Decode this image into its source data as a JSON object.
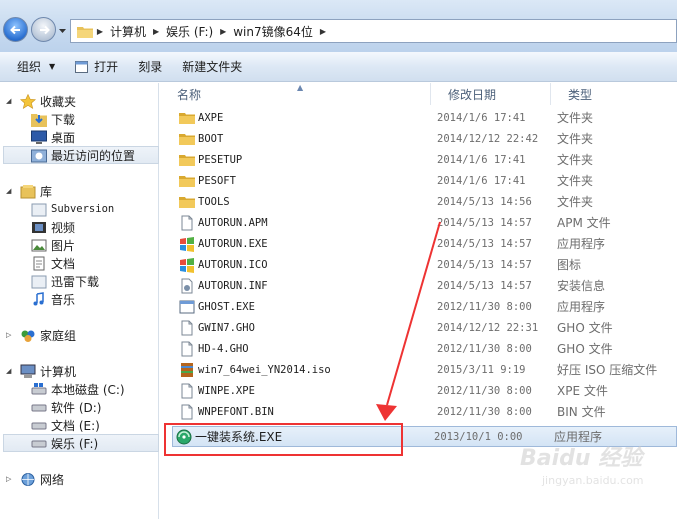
{
  "address": {
    "crumbs": [
      "计算机",
      "娱乐 (F:)",
      "win7镜像64位"
    ]
  },
  "toolbar": {
    "organize": "组织",
    "open": "打开",
    "burn": "刻录",
    "new_folder": "新建文件夹"
  },
  "nav": {
    "favorites": "收藏夹",
    "downloads": "下载",
    "desktop": "桌面",
    "recent": "最近访问的位置",
    "libraries": "库",
    "subversion": "Subversion",
    "videos": "视频",
    "pictures": "图片",
    "documents": "文档",
    "xunlei": "迅雷下载",
    "music": "音乐",
    "homegroup": "家庭组",
    "computer": "计算机",
    "drive_c": "本地磁盘 (C:)",
    "drive_d": "软件 (D:)",
    "drive_e": "文档 (E:)",
    "drive_f": "娱乐 (F:)",
    "network": "网络"
  },
  "columns": {
    "name": "名称",
    "date": "修改日期",
    "type": "类型"
  },
  "files": [
    {
      "name": "AXPE",
      "date": "2014/1/6 17:41",
      "type": "文件夹",
      "icon": "folder-icon"
    },
    {
      "name": "BOOT",
      "date": "2014/12/12 22:42",
      "type": "文件夹",
      "icon": "folder-icon"
    },
    {
      "name": "PESETUP",
      "date": "2014/1/6 17:41",
      "type": "文件夹",
      "icon": "folder-icon"
    },
    {
      "name": "PESOFT",
      "date": "2014/1/6 17:41",
      "type": "文件夹",
      "icon": "folder-icon"
    },
    {
      "name": "TOOLS",
      "date": "2014/5/13 14:56",
      "type": "文件夹",
      "icon": "folder-icon"
    },
    {
      "name": "AUTORUN.APM",
      "date": "2014/5/13 14:57",
      "type": "APM 文件",
      "icon": "blank-file-icon"
    },
    {
      "name": "AUTORUN.EXE",
      "date": "2014/5/13 14:57",
      "type": "应用程序",
      "icon": "windows-exe-icon"
    },
    {
      "name": "AUTORUN.ICO",
      "date": "2014/5/13 14:57",
      "type": "图标",
      "icon": "windows-exe-icon"
    },
    {
      "name": "AUTORUN.INF",
      "date": "2014/5/13 14:57",
      "type": "安装信息",
      "icon": "inf-file-icon"
    },
    {
      "name": "GHOST.EXE",
      "date": "2012/11/30 8:00",
      "type": "应用程序",
      "icon": "app-window-icon"
    },
    {
      "name": "GWIN7.GHO",
      "date": "2014/12/12 22:31",
      "type": "GHO 文件",
      "icon": "blank-file-icon"
    },
    {
      "name": "HD-4.GHO",
      "date": "2012/11/30 8:00",
      "type": "GHO 文件",
      "icon": "blank-file-icon"
    },
    {
      "name": "win7_64wei_YN2014.iso",
      "date": "2015/3/11 9:19",
      "type": "好压 ISO 压缩文件",
      "icon": "archive-icon"
    },
    {
      "name": "WINPE.XPE",
      "date": "2012/11/30 8:00",
      "type": "XPE 文件",
      "icon": "blank-file-icon"
    },
    {
      "name": "WNPEFONT.BIN",
      "date": "2012/11/30 8:00",
      "type": "BIN 文件",
      "icon": "blank-file-icon"
    },
    {
      "name": "一键装系统.EXE",
      "date": "2013/10/1 0:00",
      "type": "应用程序",
      "icon": "green-disc-icon"
    }
  ],
  "watermark": {
    "logo": "Baidu 经验",
    "url": "jingyan.baidu.com"
  },
  "colors": {
    "highlight_box": "#e33",
    "arrow": "#e33"
  }
}
